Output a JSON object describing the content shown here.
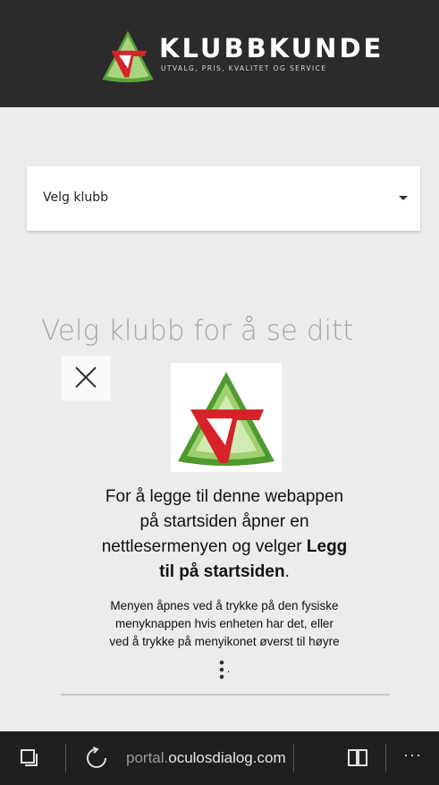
{
  "header": {
    "brand_name": "KLUBBKUNDE",
    "tagline": "UTVALG, PRIS, KVALITET OG SERVICE",
    "logo_icon": "klubbkunde-logo-icon"
  },
  "club_select": {
    "selected_label": "Velg klubb",
    "caret_icon": "caret-down-icon"
  },
  "main": {
    "heading": "Velg klubb for å se ditt"
  },
  "add_to_home_prompt": {
    "close_icon": "close-icon",
    "app_icon": "klubbkunde-app-icon",
    "line1": "For å legge til denne webappen",
    "line2": "på startsiden åpner en",
    "line3_prefix": "nettlesermenyen og velger ",
    "line3_bold": "Legg",
    "line4_bold": "til på startsiden",
    "line4_suffix": ".",
    "detail_line1": "Menyen åpnes ved å trykke på den fysiske",
    "detail_line2": "menyknappen hvis enheten har det, eller",
    "detail_line3": "ved å trykke på menyikonet øverst til høyre",
    "detail_end": "."
  },
  "browser_bar": {
    "url_protocol": "portal.",
    "url_host": "oculosdialog.com/",
    "more_label": "···",
    "tabs_icon": "tabs-icon",
    "refresh_icon": "refresh-icon",
    "reading_view_icon": "reading-view-icon"
  },
  "colors": {
    "header_bg": "#2b2b2b",
    "page_bg": "#ececec",
    "logo_red": "#d6232a",
    "logo_green": "#5aa33a",
    "logo_light_green": "#a9d47e"
  }
}
